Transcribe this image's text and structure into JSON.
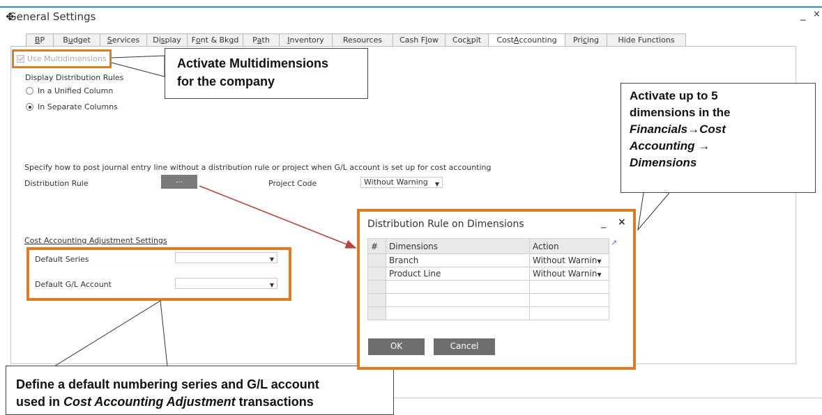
{
  "window": {
    "title": "General Settings",
    "minimize": "_",
    "close": "×"
  },
  "tabs": [
    {
      "pre": "",
      "u": "B",
      "post": "P"
    },
    {
      "pre": "B",
      "u": "u",
      "post": "dget"
    },
    {
      "pre": "",
      "u": "S",
      "post": "ervices"
    },
    {
      "pre": "Di",
      "u": "s",
      "post": "play"
    },
    {
      "pre": "F",
      "u": "o",
      "post": "nt & Bkgd"
    },
    {
      "pre": "P",
      "u": "a",
      "post": "th"
    },
    {
      "pre": "",
      "u": "I",
      "post": "nventory"
    },
    {
      "pre": "",
      "u": "",
      "post": "Resources"
    },
    {
      "pre": "Cash F",
      "u": "l",
      "post": "ow"
    },
    {
      "pre": "Coc",
      "u": "k",
      "post": "pit"
    },
    {
      "pre": "Cost ",
      "u": "A",
      "post": "ccounting"
    },
    {
      "pre": "Pri",
      "u": "c",
      "post": "ing"
    },
    {
      "pre": "",
      "u": "",
      "post": "Hide Functions"
    }
  ],
  "settings": {
    "use_multidimensions": "Use Multidimensions",
    "display_rules_label": "Display Distribution Rules",
    "radio_unified": "In a Unified Column",
    "radio_separate": "In Separate Columns",
    "specify_text": "Specify how to post journal entry line without a distribution rule or project when G/L account is set up for cost accounting",
    "distribution_rule_label": "Distribution Rule",
    "distribution_rule_button": "...",
    "project_code_label": "Project Code",
    "project_code_value": "Without Warning",
    "adjustment_header": "Cost Accounting Adjustment Settings",
    "default_series_label": "Default Series",
    "default_gl_label": "Default G/L Account"
  },
  "dialog": {
    "title": "Distribution Rule on Dimensions",
    "minimize": "_",
    "close": "×",
    "columns": [
      "#",
      "Dimensions",
      "Action"
    ],
    "rows": [
      {
        "dimension": "Branch",
        "action": "Without Warnin"
      },
      {
        "dimension": "Product Line",
        "action": "Without Warnin"
      }
    ],
    "ok_label": "OK",
    "cancel_label": "Cancel"
  },
  "callouts": {
    "multidim_line1": "Activate Multidimensions",
    "multidim_line2": "for the company",
    "dims_line1": "Activate up to 5",
    "dims_line2": "dimensions in the",
    "dims_line3": "Financials→Cost",
    "dims_line4": "Accounting →",
    "dims_line5": "Dimensions",
    "default_line1": "Define a default numbering series and G/L account",
    "default_line2_pre": "used in ",
    "default_line2_em": "Cost Accounting Adjustment",
    "default_line2_post": " transactions"
  },
  "colors": {
    "highlight": "#e07b22",
    "title_bar": "#2b8ad6",
    "arrow": "#b5473a"
  }
}
